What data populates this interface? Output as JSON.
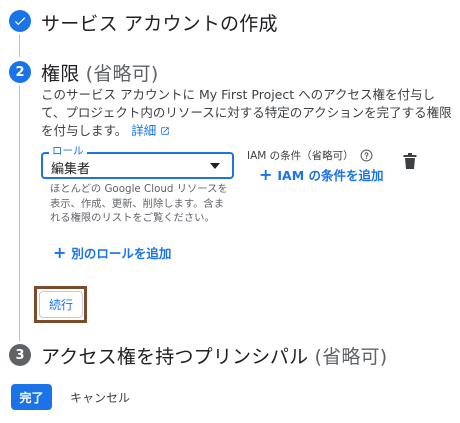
{
  "steps": {
    "step1": {
      "title": "サービス アカウントの作成",
      "state": "done"
    },
    "step2": {
      "number": "2",
      "title": "権限",
      "optional": "(省略可)",
      "description": "このサービス アカウントに My First Project へのアクセス権を付与して、プロジェクト内のリソースに対する特定のアクションを完了する権限を付与します。",
      "details_link": "詳細",
      "role": {
        "label": "ロール",
        "value": "編集者",
        "help": "ほとんどの Google Cloud リソースを表示、作成、更新、削除します。含まれる権限のリストをご覧ください。"
      },
      "iam_condition": {
        "title": "IAM の条件（省略可）",
        "add_label": "IAM の条件を追加"
      },
      "add_role_label": "別のロールを追加",
      "continue_label": "続行"
    },
    "step3": {
      "number": "3",
      "title": "アクセス権を持つプリンシパル",
      "optional": "(省略可)"
    }
  },
  "footer": {
    "done_label": "完了",
    "cancel_label": "キャンセル"
  },
  "colors": {
    "primary": "#1a73e8",
    "highlight": "#7b4b2a",
    "muted": "#5f6368"
  },
  "icons": [
    "check-icon",
    "help-circle-icon",
    "trash-icon",
    "open-in-new-icon",
    "plus-icon",
    "dropdown-arrow-icon"
  ]
}
